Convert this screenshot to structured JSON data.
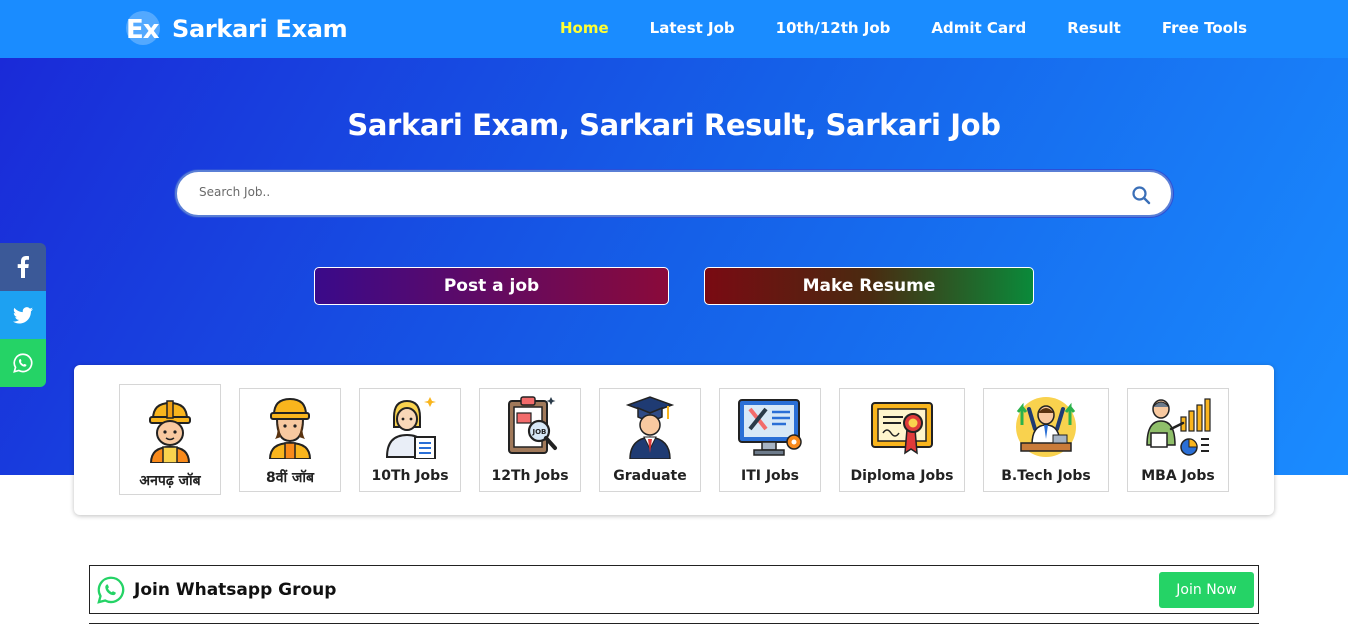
{
  "site": {
    "logo_mark": "Ex",
    "name": "Sarkari Exam"
  },
  "nav": {
    "items": [
      {
        "label": "Home",
        "active": true
      },
      {
        "label": "Latest Job",
        "active": false
      },
      {
        "label": "10th/12th Job",
        "active": false
      },
      {
        "label": "Admit Card",
        "active": false
      },
      {
        "label": "Result",
        "active": false
      },
      {
        "label": "Free Tools",
        "active": false
      }
    ]
  },
  "hero": {
    "title": "Sarkari Exam, Sarkari Result, Sarkari Job",
    "search_placeholder": "Search Job..",
    "post_job_label": "Post a job",
    "make_resume_label": "Make Resume"
  },
  "categories": [
    {
      "label": "अनपढ़ जॉब",
      "icon": "worker-helmet-icon"
    },
    {
      "label": "8वीं जॉब",
      "icon": "engineer-worker-icon"
    },
    {
      "label": "10Th Jobs",
      "icon": "office-woman-icon"
    },
    {
      "label": "12Th Jobs",
      "icon": "job-clipboard-icon"
    },
    {
      "label": "Graduate",
      "icon": "graduate-cap-icon"
    },
    {
      "label": "ITI Jobs",
      "icon": "iti-tools-monitor-icon"
    },
    {
      "label": "Diploma Jobs",
      "icon": "diploma-certificate-icon"
    },
    {
      "label": "B.Tech Jobs",
      "icon": "btech-celebration-icon"
    },
    {
      "label": "MBA Jobs",
      "icon": "mba-presentation-icon"
    }
  ],
  "social": {
    "facebook": "facebook-icon",
    "twitter": "twitter-icon",
    "whatsapp": "whatsapp-icon"
  },
  "whatsapp_group": {
    "text": "Join Whatsapp Group",
    "button_label": "Join Now"
  },
  "colors": {
    "nav_bg": "#1a8cff",
    "active_nav": "#ffff33",
    "whatsapp_green": "#25d366",
    "facebook_blue": "#3b5998",
    "twitter_blue": "#1da1f2"
  }
}
